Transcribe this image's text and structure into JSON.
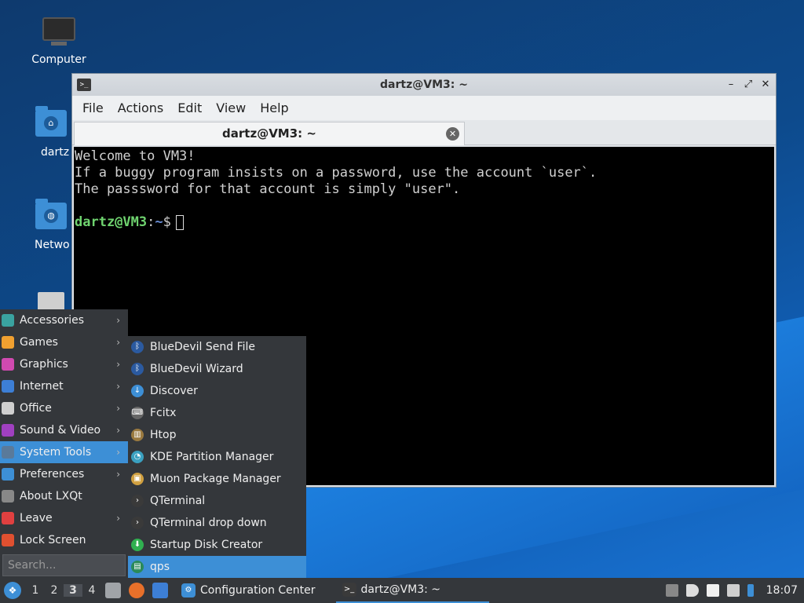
{
  "desktop": {
    "icons": [
      {
        "label": "Computer",
        "icon": "computer-icon"
      },
      {
        "label": "dartz",
        "icon": "home-folder-icon"
      },
      {
        "label": "Netwo",
        "icon": "network-folder-icon"
      },
      {
        "label": "",
        "icon": "trash-icon"
      }
    ]
  },
  "window": {
    "title": "dartz@VM3: ~",
    "menus": [
      "File",
      "Actions",
      "Edit",
      "View",
      "Help"
    ],
    "tab_label": "dartz@VM3: ~",
    "terminal": {
      "lines": [
        "Welcome to VM3!",
        "If a buggy program insists on a password, use the account `user`.",
        "The passsword for that account is simply \"user\"."
      ],
      "prompt_user": "dartz@VM3",
      "prompt_sep": ":",
      "prompt_path": "~",
      "prompt_sym": "$"
    }
  },
  "app_menu": {
    "categories": [
      {
        "label": "Accessories",
        "icon": "accessories-icon",
        "color": "#3aa3a0",
        "has_sub": true
      },
      {
        "label": "Games",
        "icon": "games-icon",
        "color": "#f0a030",
        "has_sub": true
      },
      {
        "label": "Graphics",
        "icon": "graphics-icon",
        "color": "#d04ab0",
        "has_sub": true
      },
      {
        "label": "Internet",
        "icon": "internet-icon",
        "color": "#3d7fd6",
        "has_sub": true
      },
      {
        "label": "Office",
        "icon": "office-icon",
        "color": "#cfcfcf",
        "has_sub": true
      },
      {
        "label": "Sound & Video",
        "icon": "sound-video-icon",
        "color": "#a040c0",
        "has_sub": true
      },
      {
        "label": "System Tools",
        "icon": "system-tools-icon",
        "color": "#5a7a9a",
        "has_sub": true
      },
      {
        "label": "Preferences",
        "icon": "preferences-icon",
        "color": "#3d8fd6",
        "has_sub": true
      },
      {
        "label": "About LXQt",
        "icon": "about-icon",
        "color": "#888888",
        "has_sub": false
      },
      {
        "label": "Leave",
        "icon": "power-icon",
        "color": "#e04040",
        "has_sub": true
      },
      {
        "label": "Lock Screen",
        "icon": "lock-icon",
        "color": "#e05030",
        "has_sub": false
      }
    ],
    "active_category": "System Tools",
    "search_placeholder": "Search...",
    "system_tools": [
      {
        "label": "BlueDevil Send File",
        "icon": "bluetooth-icon",
        "color": "#2b5aa0"
      },
      {
        "label": "BlueDevil Wizard",
        "icon": "bluetooth-icon",
        "color": "#2b5aa0"
      },
      {
        "label": "Discover",
        "icon": "discover-icon",
        "color": "#3d8fd6"
      },
      {
        "label": "Fcitx",
        "icon": "keyboard-icon",
        "color": "#666666"
      },
      {
        "label": "Htop",
        "icon": "htop-icon",
        "color": "#9a7a40"
      },
      {
        "label": "KDE Partition Manager",
        "icon": "partition-icon",
        "color": "#3aa0c0"
      },
      {
        "label": "Muon Package Manager",
        "icon": "package-icon",
        "color": "#d0a040"
      },
      {
        "label": "QTerminal",
        "icon": "terminal-icon",
        "color": "#3a3a3a"
      },
      {
        "label": "QTerminal drop down",
        "icon": "terminal-icon",
        "color": "#3a3a3a"
      },
      {
        "label": "Startup Disk Creator",
        "icon": "startup-disk-icon",
        "color": "#30b050"
      },
      {
        "label": "qps",
        "icon": "qps-icon",
        "color": "#2a8a5a"
      }
    ],
    "active_item": "qps"
  },
  "taskbar": {
    "desktops": [
      "1",
      "2",
      "3",
      "4"
    ],
    "active_desktop": "3",
    "tasks": [
      {
        "label": "Configuration Center",
        "icon": "configuration-icon"
      },
      {
        "label": "dartz@VM3: ~",
        "icon": "terminal-icon"
      }
    ],
    "clock": "18:07"
  },
  "colors": {
    "accent": "#3d8fd6",
    "panel": "#34373b"
  }
}
